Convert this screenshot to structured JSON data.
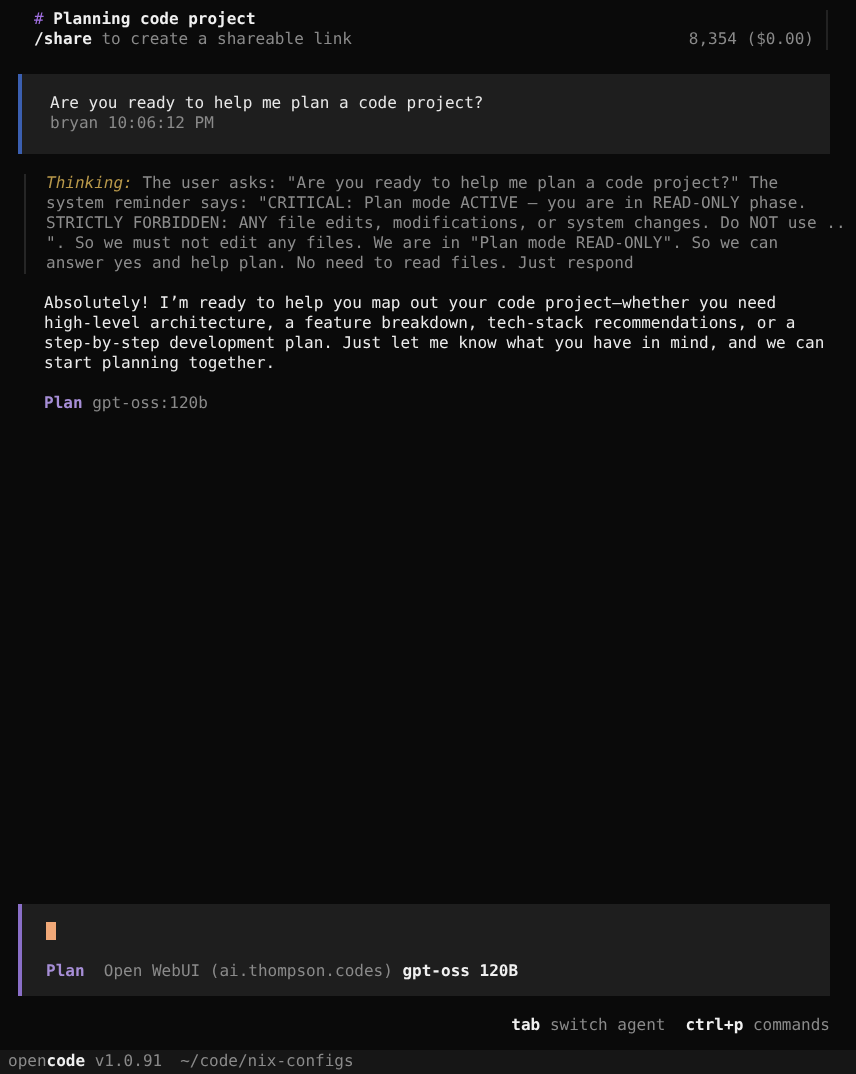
{
  "header": {
    "title_mark": "#",
    "title": "Planning code project",
    "share_command": "/share",
    "share_hint": "to create a shareable link",
    "tokens": "8,354 ($0.00)"
  },
  "user_message": {
    "text": "Are you ready to help me plan a code project?",
    "author": "bryan",
    "time": "10:06:12 PM"
  },
  "thinking": {
    "label": "Thinking:",
    "lines": [
      "The user asks: \"Are you ready to help me plan a code project?\" The",
      "system reminder says: \"CRITICAL: Plan mode ACTIVE – you are in READ-ONLY phase.",
      "STRICTLY FORBIDDEN: ANY file edits, modifications, or system changes. Do NOT use ..",
      "\". So we must not edit any files. We are in \"Plan mode READ-ONLY\". So we can",
      "answer yes and help plan. No need to read files. Just respond"
    ]
  },
  "response": {
    "lines": [
      "Absolutely! I’m ready to help you map out your code project—whether you need",
      "high-level architecture, a feature breakdown, tech-stack recommendations, or a",
      "step-by-step development plan. Just let me know what you have in mind, and we can",
      "start planning together."
    ],
    "agent": "Plan",
    "model": "gpt-oss:120b"
  },
  "prompt": {
    "agent": "Plan",
    "provider": "Open WebUI (ai.thompson.codes)",
    "model": "gpt-oss 120B"
  },
  "hints": [
    {
      "key": "tab",
      "label": "switch agent"
    },
    {
      "key": "ctrl+p",
      "label": "commands"
    }
  ],
  "status_bar": {
    "app_dim": "open",
    "app_bold": "code",
    "version": "v1.0.91",
    "path": "~/code/nix-configs"
  }
}
